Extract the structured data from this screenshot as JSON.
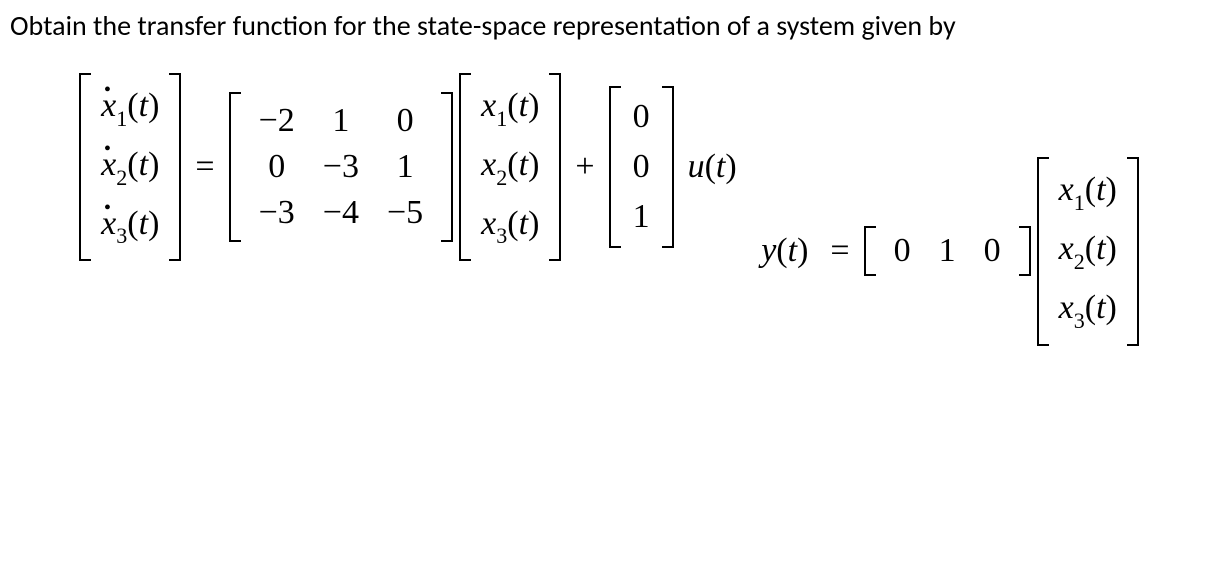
{
  "prompt": "Obtain the transfer function for the state-space representation of a system given by",
  "eq1": {
    "lhs_vec": [
      "ẋ₁(t)",
      "ẋ₂(t)",
      "ẋ₃(t)"
    ],
    "A": [
      [
        "−2",
        "1",
        "0"
      ],
      [
        "0",
        "−3",
        "1"
      ],
      [
        "−3",
        "−4",
        "−5"
      ]
    ],
    "x_vec": [
      "x₁(t)",
      "x₂(t)",
      "x₃(t)"
    ],
    "B": [
      "0",
      "0",
      "1"
    ],
    "u": "u(t)",
    "eq": "=",
    "plus": "+"
  },
  "eq2": {
    "y": "y(t)",
    "eq": "=",
    "C": [
      "0",
      "1",
      "0"
    ],
    "x_vec": [
      "x₁(t)",
      "x₂(t)",
      "x₃(t)"
    ]
  },
  "chart_data": {
    "type": "table",
    "title": "State-space matrices",
    "A": [
      [
        -2,
        1,
        0
      ],
      [
        0,
        -3,
        1
      ],
      [
        -3,
        -4,
        -5
      ]
    ],
    "B": [
      [
        0
      ],
      [
        0
      ],
      [
        1
      ]
    ],
    "C": [
      [
        0,
        1,
        0
      ]
    ],
    "state_vector": [
      "x1(t)",
      "x2(t)",
      "x3(t)"
    ],
    "state_derivative_vector": [
      "x1_dot(t)",
      "x2_dot(t)",
      "x3_dot(t)"
    ],
    "input": "u(t)",
    "output": "y(t)"
  }
}
